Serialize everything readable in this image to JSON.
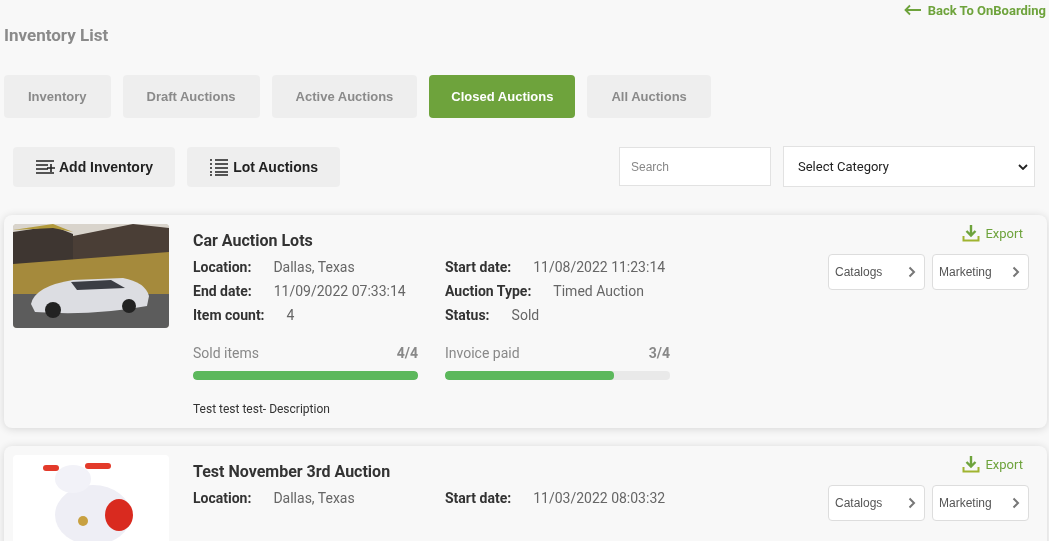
{
  "back_link": "Back To OnBoarding",
  "page_title": "Inventory List",
  "tabs": [
    {
      "label": "Inventory",
      "selected": false
    },
    {
      "label": "Draft Auctions",
      "selected": false
    },
    {
      "label": "Active Auctions",
      "selected": false
    },
    {
      "label": "Closed Auctions",
      "selected": true
    },
    {
      "label": "All Auctions",
      "selected": false
    }
  ],
  "actions": [
    {
      "label": "Add Inventory",
      "kind": "add"
    },
    {
      "label": "Lot Auctions",
      "kind": "list"
    }
  ],
  "search": {
    "placeholder": "Search"
  },
  "category_select": {
    "value": "Select Category"
  },
  "auctions": [
    {
      "title": "Car Auction Lots",
      "export": "Export",
      "buttons": [
        "Catalogs",
        "Marketing"
      ],
      "fields": [
        {
          "label": "Location:",
          "value": "Dallas, Texas"
        },
        {
          "label": "Start date:",
          "value": "11/08/2022 11:23:14"
        },
        {
          "label": "End date:",
          "value": "11/09/2022 07:33:14"
        },
        {
          "label": "Auction Type:",
          "value": "Timed Auction"
        },
        {
          "label": "Item count:",
          "value": "4"
        },
        {
          "label": "Status:",
          "value": "Sold"
        }
      ],
      "progress": [
        {
          "label": "Sold items",
          "reading": "4/4",
          "level": 1
        },
        {
          "label": "Invoice paid",
          "reading": "3/4",
          "level": 0.75
        }
      ],
      "description": "Test test test- Description"
    },
    {
      "title": "Test November 3rd Auction",
      "export": "Export",
      "buttons": [
        "Catalogs",
        "Marketing"
      ],
      "fields": [
        {
          "label": "Location:",
          "value": "Dallas, Texas"
        },
        {
          "label": "Start date:",
          "value": "11/03/2022 08:03:32"
        }
      ]
    }
  ]
}
